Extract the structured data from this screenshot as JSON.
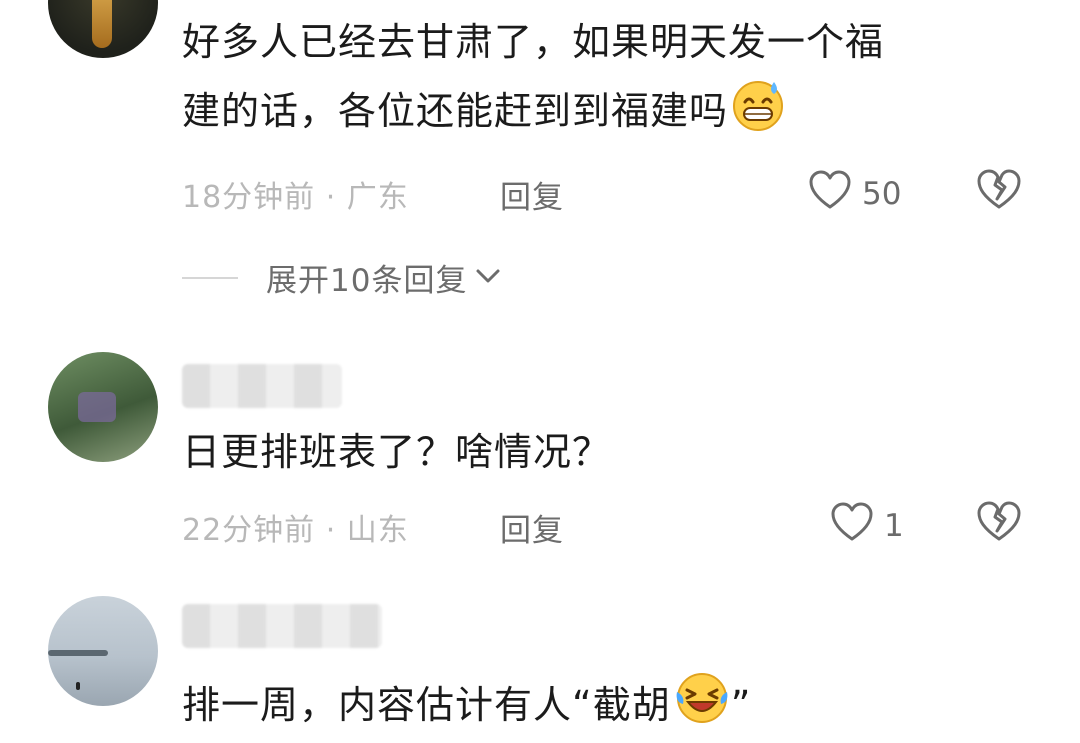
{
  "comments": [
    {
      "text_line1": "好多人已经去甘肃了，如果明天发一个福",
      "text_line2": "建的话，各位还能赶到到福建吗",
      "emoji": "grinning-sweat-emoji",
      "time_location": "18分钟前 · 广东",
      "reply_label": "回复",
      "likes": "50",
      "expand_label": "展开10条回复"
    },
    {
      "text": "日更排班表了？啥情况？",
      "time_location": "22分钟前 · 山东",
      "reply_label": "回复",
      "likes": "1"
    },
    {
      "text": "排一周，内容估计有人“截胡",
      "emoji": "laughing-tears-emoji",
      "text_tail": "”"
    }
  ],
  "icons": {
    "like": "heart-outline-icon",
    "dislike": "broken-heart-icon",
    "expand": "chevron-down-icon"
  },
  "colors": {
    "text": "#1b1b1b",
    "meta": "#b8b8b8",
    "action": "#6c6c6c"
  }
}
